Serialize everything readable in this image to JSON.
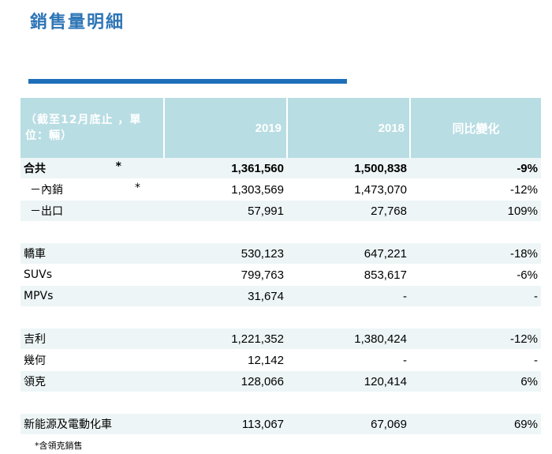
{
  "title": "銷售量明細",
  "header": {
    "unit": "（截至12月底止 ，單位：輛）",
    "col_2019": "2019",
    "col_2018": "2018",
    "col_change": "同比變化"
  },
  "rows": [
    {
      "label": "合共",
      "mark": "*",
      "v2019": "1,361,560",
      "v2018": "1,500,838",
      "change": "-9%"
    },
    {
      "label": "－內銷",
      "mark": "*",
      "v2019": "1,303,569",
      "v2018": "1,473,070",
      "change": "-12%"
    },
    {
      "label": "－出口",
      "mark": "",
      "v2019": "57,991",
      "v2018": "27,768",
      "change": "109%"
    },
    {
      "label": "轎車",
      "mark": "",
      "v2019": "530,123",
      "v2018": "647,221",
      "change": "-18%"
    },
    {
      "label": "SUVs",
      "mark": "",
      "v2019": "799,763",
      "v2018": "853,617",
      "change": "-6%"
    },
    {
      "label": "MPVs",
      "mark": "",
      "v2019": "31,674",
      "v2018": "-",
      "change": "-"
    },
    {
      "label": "吉利",
      "mark": "",
      "v2019": "1,221,352",
      "v2018": "1,380,424",
      "change": "-12%"
    },
    {
      "label": "幾何",
      "mark": "",
      "v2019": "12,142",
      "v2018": "-",
      "change": "-"
    },
    {
      "label": "領克",
      "mark": "",
      "v2019": "128,066",
      "v2018": "120,414",
      "change": "6%"
    },
    {
      "label": "新能源及電動化車",
      "mark": "",
      "v2019": "113,067",
      "v2018": "67,069",
      "change": "69%"
    }
  ],
  "footnote": "*含領克銷售"
}
